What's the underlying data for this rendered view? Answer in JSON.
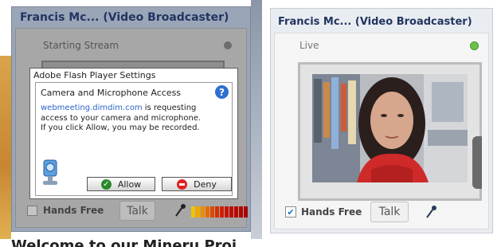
{
  "left_window": {
    "title": "Francis Mc... (Video Broadcaster)",
    "status": "Starting Stream",
    "hands_free_label": "Hands Free",
    "hands_free_checked": false,
    "talk_label": "Talk",
    "meter_colors": [
      "#f2c200",
      "#f0a800",
      "#ec8c00",
      "#e56a00",
      "#dc4a00",
      "#d43000",
      "#cc1f00",
      "#c61400",
      "#bf0d00",
      "#b80800",
      "#b00500",
      "#a80200"
    ]
  },
  "flash_dialog": {
    "title": "Adobe Flash Player Settings",
    "heading": "Camera and Microphone Access",
    "host": "webmeeting.dimdim.com",
    "message_line1": " is requesting",
    "message_line2": "access to your camera and microphone.",
    "message_line3": "If you click Allow, you may be recorded.",
    "allow_label": "Allow",
    "deny_label": "Deny",
    "help_icon": "help-icon"
  },
  "page_footer": {
    "welcome_text": "Welcome to our Mineru Proj"
  },
  "right_window": {
    "title": "Francis Mc... (Video Broadcaster)",
    "status": "Live",
    "status_color": "#6cc04a",
    "hands_free_label": "Hands Free",
    "hands_free_checked": true,
    "check_mark": "✔",
    "talk_label": "Talk"
  }
}
